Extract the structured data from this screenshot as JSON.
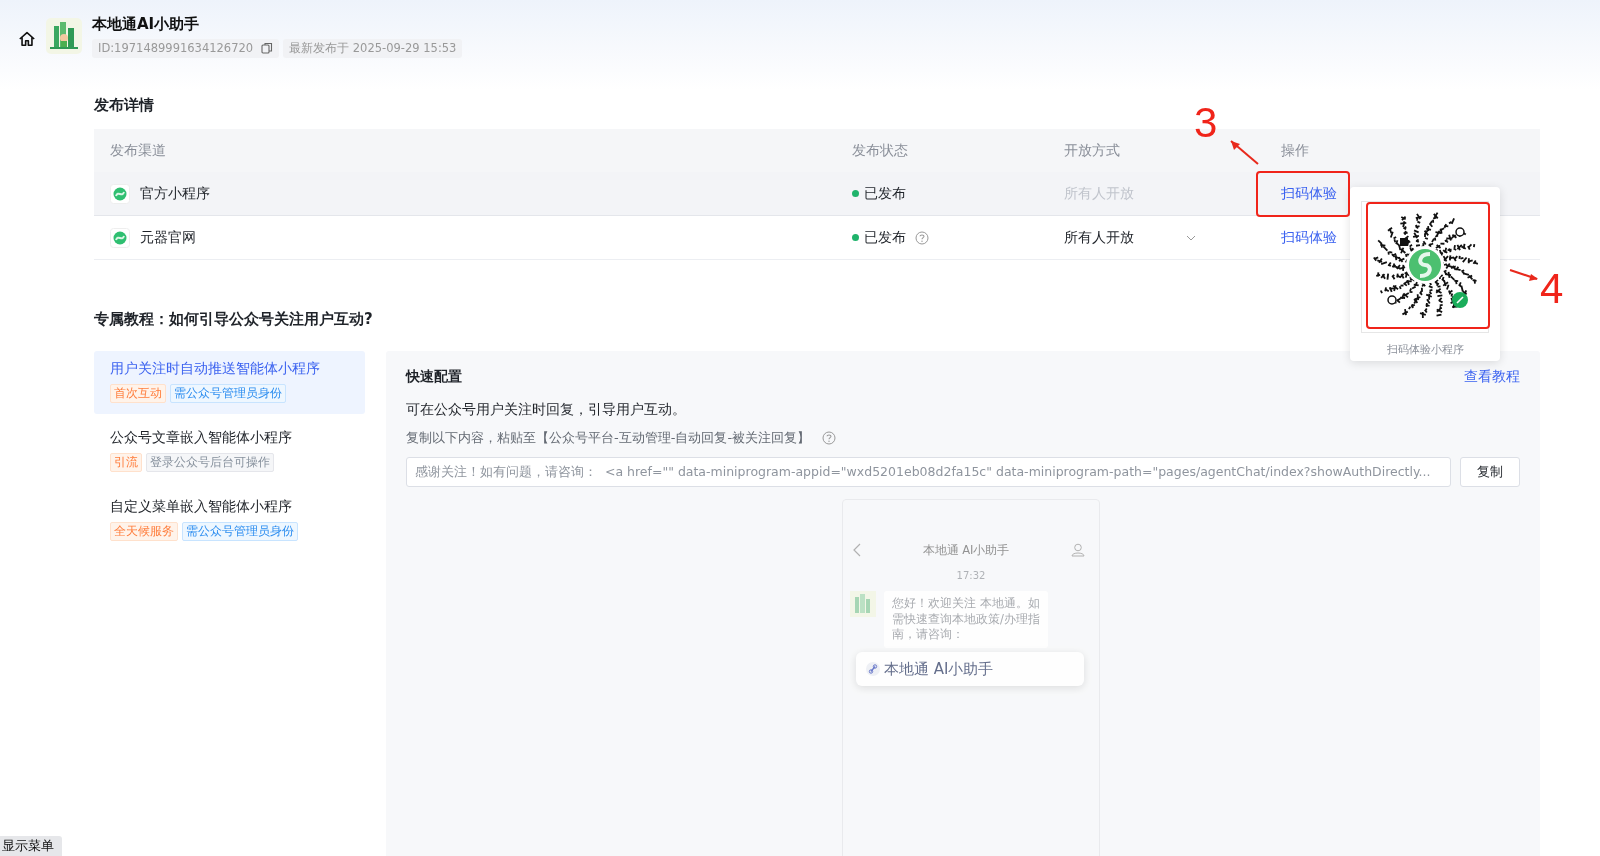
{
  "app": {
    "title": "本地通AI小助手",
    "id": "ID:1971489991634126720",
    "published": "最新发布于 2025-09-29 15:53"
  },
  "publish": {
    "title": "发布详情",
    "columns": [
      "发布渠道",
      "发布状态",
      "开放方式",
      "操作"
    ],
    "rows": [
      {
        "channel": "官方小程序",
        "status": "已发布",
        "status_help": false,
        "access": "所有人开放",
        "access_disabled": true,
        "action": "扫码体验",
        "hovered": true
      },
      {
        "channel": "元器官网",
        "status": "已发布",
        "status_help": true,
        "access": "所有人开放",
        "access_disabled": false,
        "action": "扫码体验",
        "hovered": false
      }
    ]
  },
  "qr_popover": {
    "caption": "扫码体验小程序"
  },
  "tutorial": {
    "title": "专属教程：如何引导公众号关注用户互动?",
    "items": [
      {
        "title": "用户关注时自动推送智能体小程序",
        "selected": true,
        "tags": [
          {
            "text": "首次互动",
            "kind": "scene"
          },
          {
            "text": "需公众号管理员身份",
            "kind": "requirement"
          }
        ]
      },
      {
        "title": "公众号文章嵌入智能体小程序",
        "selected": false,
        "tags": [
          {
            "text": "引流",
            "kind": "scene"
          },
          {
            "text": "登录公众号后台可操作",
            "kind": "note"
          }
        ]
      },
      {
        "title": "自定义菜单嵌入智能体小程序",
        "selected": false,
        "tags": [
          {
            "text": "全天候服务",
            "kind": "scene"
          },
          {
            "text": "需公众号管理员身份",
            "kind": "requirement"
          }
        ]
      }
    ]
  },
  "config": {
    "title": "快速配置",
    "link": "查看教程",
    "description": "可在公众号用户关注时回复，引导用户互动。",
    "hint": "复制以下内容，粘贴至【公众号平台-互动管理-自动回复-被关注回复】",
    "snippet": "感谢关注！如有问题，请咨询：  <a href=\"\" data-miniprogram-appid=\"wxd5201eb08d2fa15c\" data-miniprogram-path=\"pages/agentChat/index?showAuthDirectly...",
    "copy": "复制"
  },
  "preview": {
    "title": "本地通 AI小助手",
    "time": "17:32",
    "message": "您好！欢迎关注 本地通。如需快速查询本地政策/办理指南，请咨询：",
    "card": "本地通 AI小助手"
  },
  "menu_toggle": "显示菜单",
  "annotations": [
    {
      "label": "3"
    },
    {
      "label": "4"
    }
  ]
}
